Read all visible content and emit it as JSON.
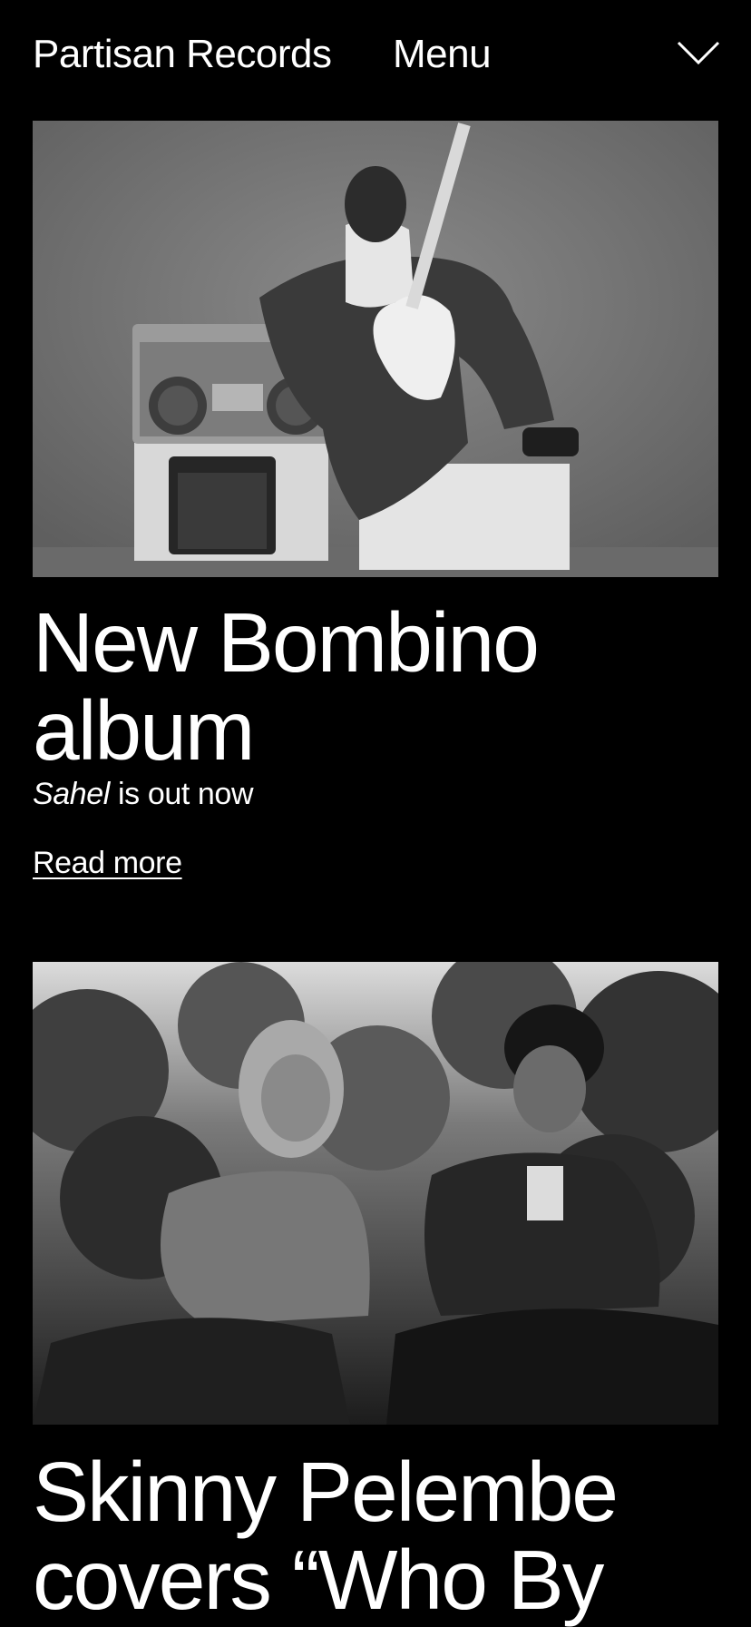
{
  "header": {
    "brand": "Partisan Records",
    "menu_label": "Menu",
    "toggle_icon": "chevron-down-icon"
  },
  "articles": [
    {
      "image_alt": "Bombino seated with a white electric guitar beside a boombox and amplifier",
      "headline": "New Bombino album",
      "subtitle_italic": "Sahel",
      "subtitle_rest": " is out now",
      "link_label": "Read more"
    },
    {
      "image_alt": "Skinny Pelembe duo seated outdoors in front of trees",
      "headline": "Skinny Pelembe covers “Who By"
    }
  ],
  "colors": {
    "background": "#000000",
    "text": "#ffffff"
  }
}
